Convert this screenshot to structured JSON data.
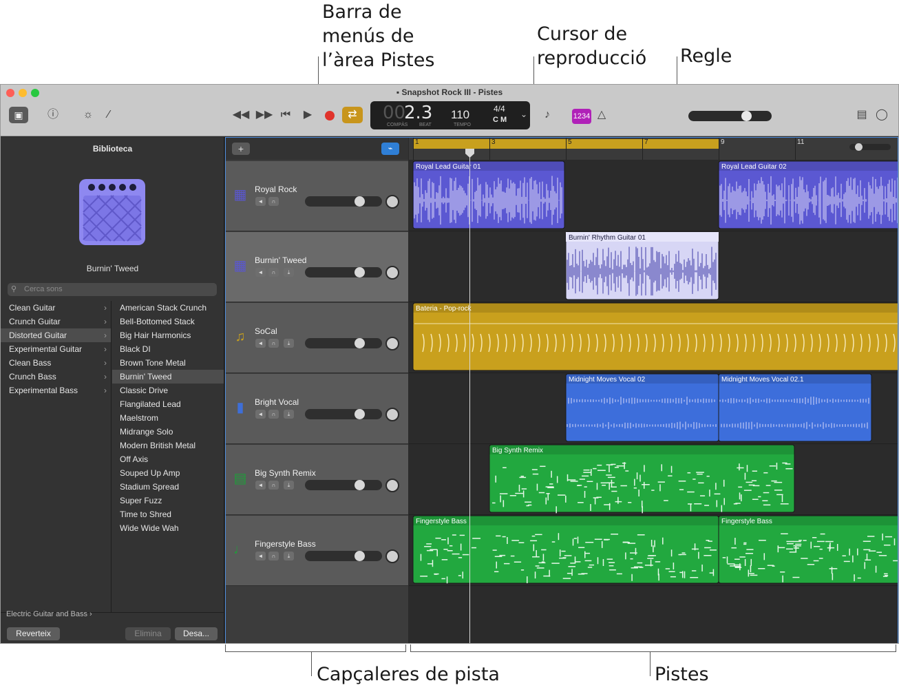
{
  "callouts": {
    "menubar": "Barra de\nmenús de\nl’àrea Pistes",
    "playhead": "Cursor de\nreproducció",
    "ruler": "Regle",
    "headers": "Capçaleres de pista",
    "tracks": "Pistes"
  },
  "window": {
    "title": "Snapshot Rock III - Pistes",
    "lcd": {
      "bar": "2.3",
      "bar_dim": "00",
      "bar_label": "COMPÀS",
      "beat_label": "BEAT",
      "tempo": "110",
      "tempo_label": "TEMPO",
      "signature": "4/4",
      "key": "C M"
    },
    "count_in": "1234"
  },
  "library": {
    "title": "Biblioteca",
    "patch_name": "Burnin' Tweed",
    "search_placeholder": "Cerca sons",
    "categories": [
      "Clean Guitar",
      "Crunch Guitar",
      "Distorted Guitar",
      "Experimental Guitar",
      "Clean Bass",
      "Crunch Bass",
      "Experimental Bass"
    ],
    "selected_category": "Distorted Guitar",
    "patches": [
      "American Stack Crunch",
      "Bell-Bottomed Stack",
      "Big Hair Harmonics",
      "Black DI",
      "Brown Tone Metal",
      "Burnin' Tweed",
      "Classic Drive",
      "Flangilated Lead",
      "Maelstrom",
      "Midrange Solo",
      "Modern British Metal",
      "Off Axis",
      "Souped Up Amp",
      "Stadium Spread",
      "Super Fuzz",
      "Time to Shred",
      "Wide Wide Wah"
    ],
    "selected_patch": "Burnin' Tweed",
    "breadcrumb": "Electric Guitar and Bass",
    "buttons": {
      "revert": "Reverteix",
      "delete": "Elimina",
      "save": "Desa..."
    }
  },
  "ruler": {
    "bars": [
      "1",
      "3",
      "5",
      "7",
      "9",
      "11"
    ]
  },
  "tracks": [
    {
      "name": "Royal Rock",
      "icon": "amp-icon",
      "color": "#5a57d0"
    },
    {
      "name": "Burnin' Tweed",
      "icon": "amp-icon",
      "color": "#5a57d0"
    },
    {
      "name": "SoCal",
      "icon": "drums-icon",
      "color": "#c8a01e"
    },
    {
      "name": "Bright Vocal",
      "icon": "microphone-icon",
      "color": "#3e6fd8"
    },
    {
      "name": "Big Synth Remix",
      "icon": "keyboard-icon",
      "color": "#1f9e3a"
    },
    {
      "name": "Fingerstyle Bass",
      "icon": "bass-guitar-icon",
      "color": "#1f9e3a"
    }
  ],
  "regions": [
    {
      "track": 0,
      "name": "Royal Lead Guitar 01",
      "color": "#5b58d2"
    },
    {
      "track": 0,
      "name": "Royal Lead Guitar 02",
      "color": "#5b58d2"
    },
    {
      "track": 1,
      "name": "Burnin' Rhythm Guitar 01",
      "color": "#d7d6f5"
    },
    {
      "track": 2,
      "name": "Bateria - Pop-rock",
      "color": "#c9a01d"
    },
    {
      "track": 3,
      "name": "Midnight Moves Vocal 02",
      "color": "#3d6edb"
    },
    {
      "track": 3,
      "name": "Midnight Moves Vocal 02.1",
      "color": "#3d6edb"
    },
    {
      "track": 4,
      "name": "Big Synth Remix",
      "color": "#22a83f"
    },
    {
      "track": 5,
      "name": "Fingerstyle Bass",
      "color": "#22a83f"
    },
    {
      "track": 5,
      "name": "Fingerstyle Bass",
      "color": "#22a83f"
    }
  ]
}
